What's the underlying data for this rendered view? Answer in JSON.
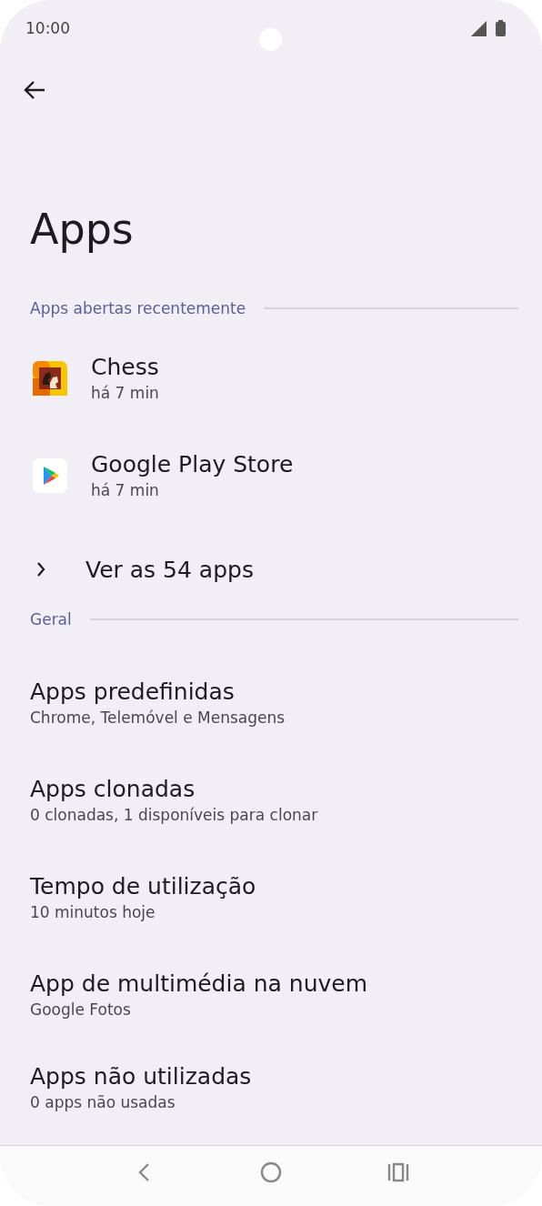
{
  "status_bar": {
    "time": "10:00"
  },
  "title": "Apps",
  "recent_section": {
    "header": "Apps abertas recentemente",
    "apps": [
      {
        "kind": "chess",
        "name": "Chess",
        "time": "há 7 min"
      },
      {
        "kind": "play",
        "name": "Google Play Store",
        "time": "há 7 min"
      }
    ],
    "see_all": "Ver as 54 apps"
  },
  "general_section": {
    "header": "Geral",
    "items": [
      {
        "title": "Apps predefinidas",
        "subtitle": "Chrome, Telemóvel e Mensagens"
      },
      {
        "title": "Apps clonadas",
        "subtitle": "0 clonadas, 1 disponíveis para clonar"
      },
      {
        "title": "Tempo de utilização",
        "subtitle": "10 minutos hoje"
      },
      {
        "title": "App de multimédia na nuvem",
        "subtitle": "Google Fotos"
      },
      {
        "title": "Apps não utilizadas",
        "subtitle": "0 apps não usadas"
      }
    ]
  }
}
